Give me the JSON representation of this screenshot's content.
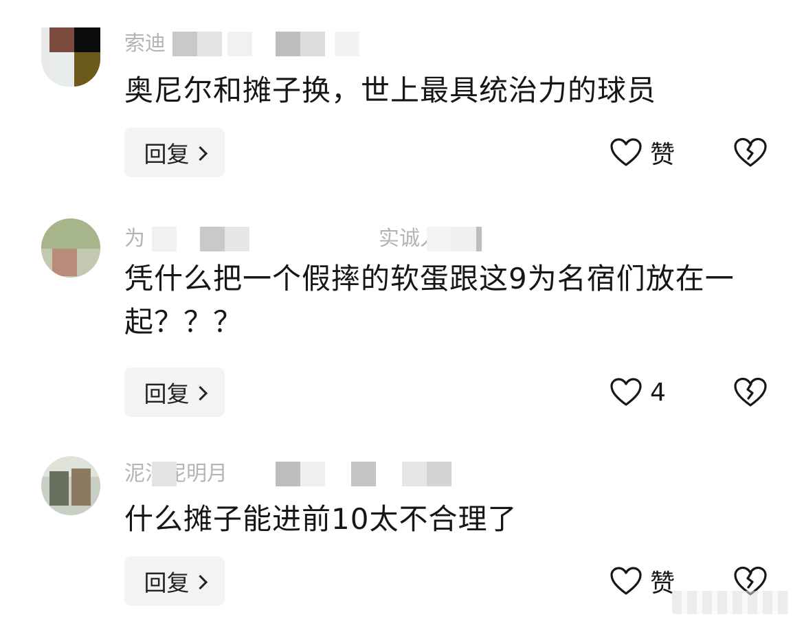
{
  "comments": [
    {
      "author_partial": "索迪",
      "text": "奥尼尔和摊子换，世上最具统治力的球员",
      "reply_label": "回复",
      "like_label": "赞",
      "avatar_colors": [
        "#7a4a3c",
        "#0c0c0c",
        "#e8ecea",
        "#6b5a1a"
      ]
    },
    {
      "author_partial": "为",
      "author_partial_2": "实诚人",
      "text": "凭什么把一个假摔的软蛋跟这9为名宿们放在一起？？？",
      "reply_label": "回复",
      "like_label": "4",
      "avatar_colors": [
        "#a7b58a",
        "#b98b7a"
      ]
    },
    {
      "author_partial": "泥泞泥明月",
      "text": "什么摊子能进前10太不合理了",
      "reply_label": "回复",
      "like_label": "赞",
      "avatar_colors": [
        "#66705d",
        "#8b7a5f"
      ]
    }
  ],
  "icons": {
    "like": "heart-outline-icon",
    "dislike": "broken-heart-icon",
    "reply_chevron": "chevron-right-icon"
  },
  "colors": {
    "text": "#161616",
    "meta": "#b4b4b4",
    "reply_bg": "#f3f3f3"
  }
}
